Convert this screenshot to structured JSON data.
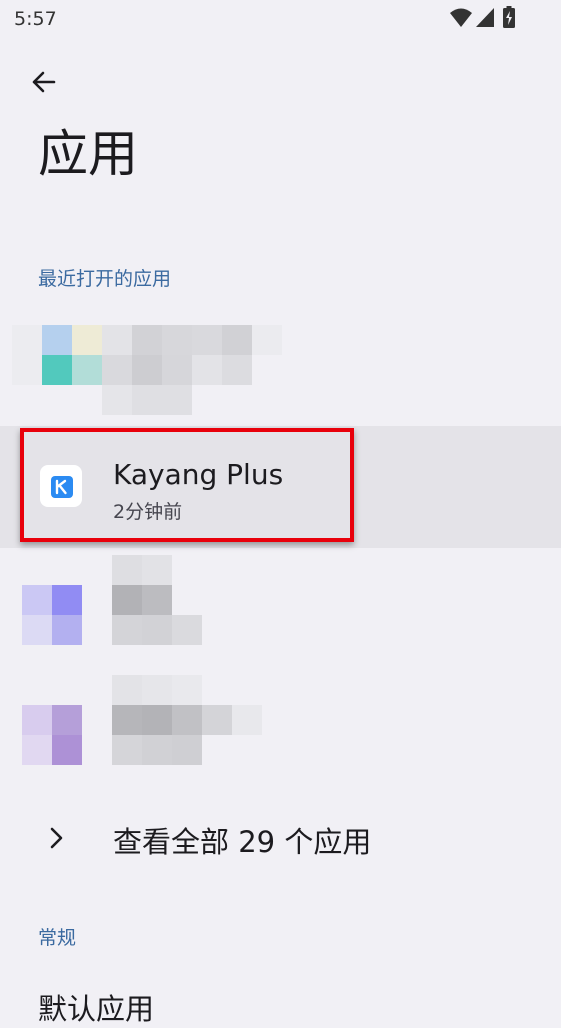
{
  "status_bar": {
    "time": "5:57"
  },
  "header": {
    "title": "应用"
  },
  "sections": {
    "recent_label": "最近打开的应用",
    "general_label": "常规"
  },
  "recent_apps": [
    {
      "name": "Kayang Plus",
      "time": "2分钟前",
      "highlighted": true
    }
  ],
  "see_all": {
    "label": "查看全部 29 个应用"
  },
  "general_items": [
    {
      "label": "默认应用"
    }
  ],
  "colors": {
    "accent": "#3b6aa0",
    "highlight_border": "#e8000b",
    "app_icon_blue": "#2b8bf2"
  }
}
